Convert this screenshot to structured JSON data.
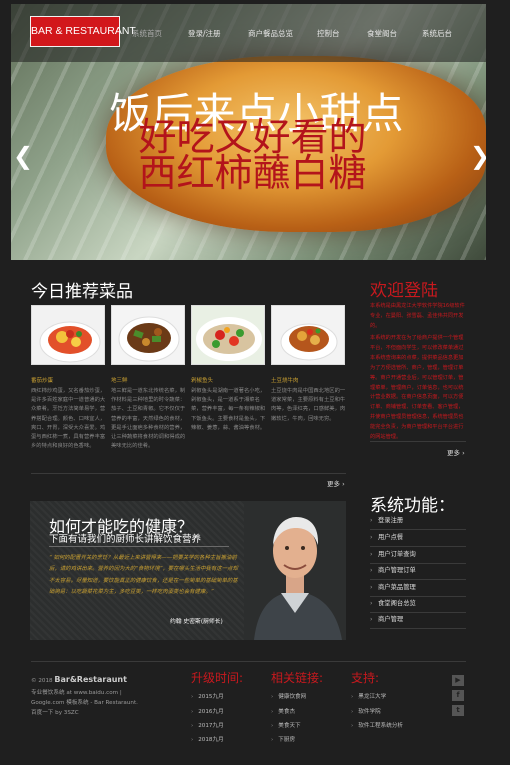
{
  "header": {
    "logo": "BAR & RESTAURANT",
    "nav": [
      "系统首页",
      "登录/注册",
      "商户餐品总览",
      "控制台",
      "食堂阁台",
      "系统后台"
    ]
  },
  "hero": {
    "line1": "饭后来点小甜点",
    "line2": "好吃又好看的",
    "line3": "西红柿蘸白糖",
    "prev": "❮",
    "next": "❯"
  },
  "recommend": {
    "title": "今日推荐菜品",
    "dishes": [
      {
        "name": "番茄炒蛋",
        "desc": "西红柿炒鸡蛋，又名番茄炒蛋，是许多百姓家庭中一道普通的大众菜肴。烹饪方法简单易学，营养搭配合理。颜色、口味宜人，爽口、开胃，深受大众喜爱。鸡蛋与西红柿一煮，具有营养丰富乡的特点和良好的色香味。"
      },
      {
        "name": "地三鲜",
        "desc": "地三鲜是一道东北传统名菜，制作材料是三种地里的时令蔬菜：茄子、土豆和青椒。它不仅仅于营养的丰富，天然绿色的食材，更是手让面疤多种食材的营养，让三种蔬菜将食材的调和得成的美味无比的佳肴。"
      },
      {
        "name": "剁椒鱼头",
        "desc": "剁椒鱼头是湖南一道著名小吃，剁椒鱼头，是一道系于湘菜名菜，营养丰富，每一条有辣椒和下饭鱼头。主要食材是鱼头，下辣椒、姜葱，蒜、酱油等食材。"
      },
      {
        "name": "土豆烧牛肉",
        "desc": "土豆烧牛肉是中国西北地区的一道家常菜，主要原料有土豆和牛肉等，色泽红亮，口感鲜美，肉嫩软烂，牛肉，回味无穷。"
      }
    ],
    "more": "更多"
  },
  "health": {
    "title": "如何才能吃的健康？",
    "subtitle": "下面有请我们的厨师长讲解饮食营养",
    "quote": "“ 如何的配置开关的烹饪？从最近上来讲营得来——把要关学的各种主旨搬油前后，请的鸡讲出来。营养的因为大的“食物环境”，要在哪头生活中我有这一点却不太容易。尽量知道，要饮能真正的健康饮食，还是在一些简单的基础简单的基础简易：以吃蔬菜花菜为主，多吃豆类，一样吃肉蛋类也会有健康。”",
    "signature": "约翰 史密斯(厨师长)"
  },
  "welcome": {
    "title": "欢迎登陆",
    "p1": "本系统是由黑龙江大学软件学院16级软件专业，在曼阳、张雪磊、孟佳伟共同开发的。",
    "p2": "本系统的开发在为了给商户提供一个管理平台，不但面向学生，可以修改菜单通过本系统查询来的点菜，提供菜品信息更加为了方便选管所、商户，管理，管理订单等。商户开通营业后，可以管理订单，管理菜单，管理商户，订单信息，也可以统计营业数据。在商户信息页面，可以方便订单、商铺管理、订单查看、客户管理，并使商户管理员管理信息，系统管理员也能完全负责，为商户管理和平台平台进行的网站管理。"
  },
  "functions": {
    "title": "系统功能：",
    "items": [
      "登录注册",
      "用户点餐",
      "用户订单查询",
      "商户管理订单",
      "商户菜品管理",
      "食堂阁台总览",
      "商户管理"
    ]
  },
  "footer": {
    "copyright": "© 2018",
    "brand": "Bar&Restaraunt",
    "line2": "专业餐饮系统 at www.baidu.com |",
    "line3": "Google.com 模板系统 - Bar Restaraunt.",
    "line4": "百度一下 by 3SZC",
    "col1": {
      "title": "升级时间:",
      "links": [
        "2015九月",
        "2016九月",
        "2017九月",
        "2018九月"
      ]
    },
    "col2": {
      "title": "相关链接:",
      "links": [
        "健康饮食网",
        "美食杰",
        "美食天下",
        "下厨房"
      ]
    },
    "col3": {
      "title": "支持:",
      "links": [
        "黑龙江大学",
        "软件学院",
        "软件工程系统分析"
      ]
    },
    "social": [
      "youtube-icon",
      "facebook-icon",
      "twitter-icon"
    ]
  }
}
